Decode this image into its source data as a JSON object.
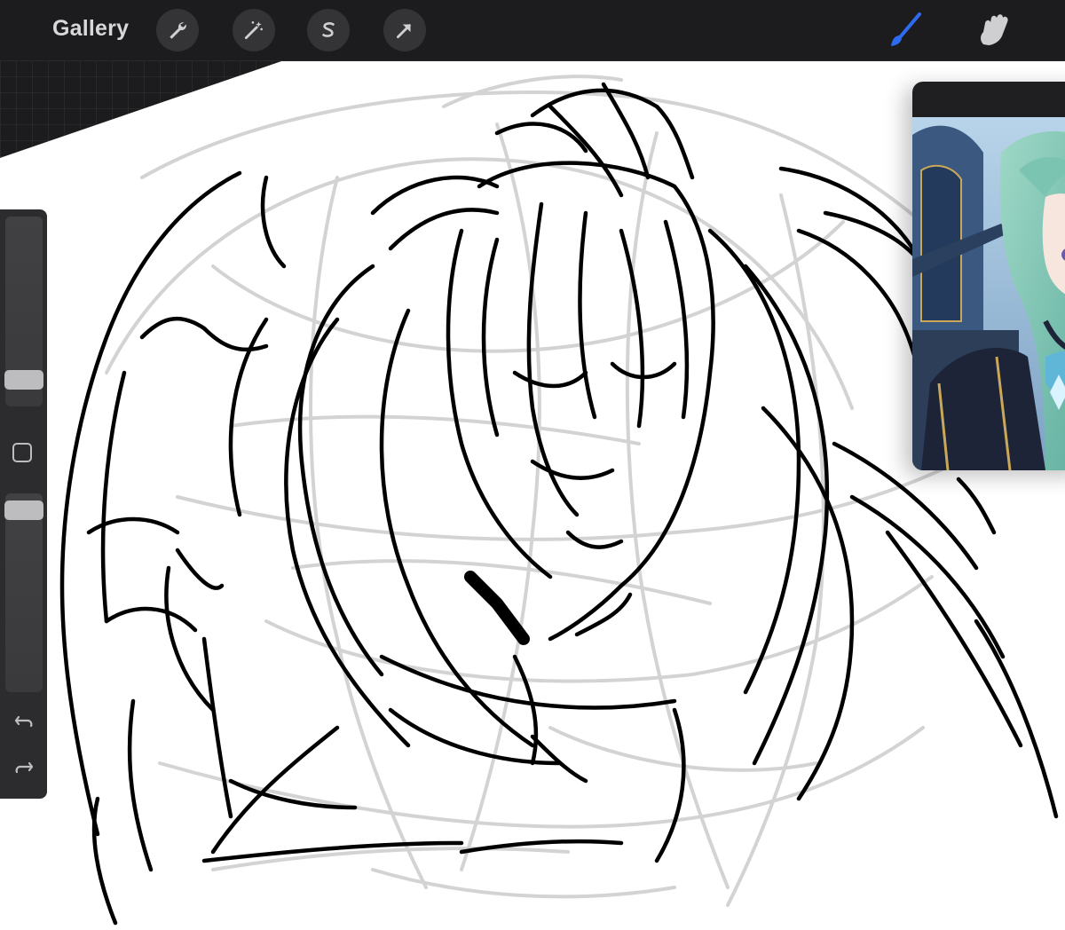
{
  "toolbar": {
    "gallery_label": "Gallery",
    "tools": [
      {
        "name": "actions",
        "icon": "wrench-icon"
      },
      {
        "name": "adjustments",
        "icon": "magic-wand-icon"
      },
      {
        "name": "selection",
        "icon": "selection-s-icon"
      },
      {
        "name": "transform",
        "icon": "arrow-icon"
      }
    ],
    "right_tools": [
      {
        "name": "brush",
        "icon": "brush-icon",
        "active": true
      },
      {
        "name": "smudge",
        "icon": "smudge-icon",
        "active": false
      }
    ],
    "accent": "#2d6cf0"
  },
  "sidebar": {
    "brush_size_level": 0.81,
    "opacity_level": 0.97,
    "modify_button": "square-icon",
    "undo": "undo-icon",
    "redo": "redo-icon"
  },
  "reference": {
    "content": "reference-image"
  },
  "canvas": {
    "content": "line-art-sketch"
  }
}
